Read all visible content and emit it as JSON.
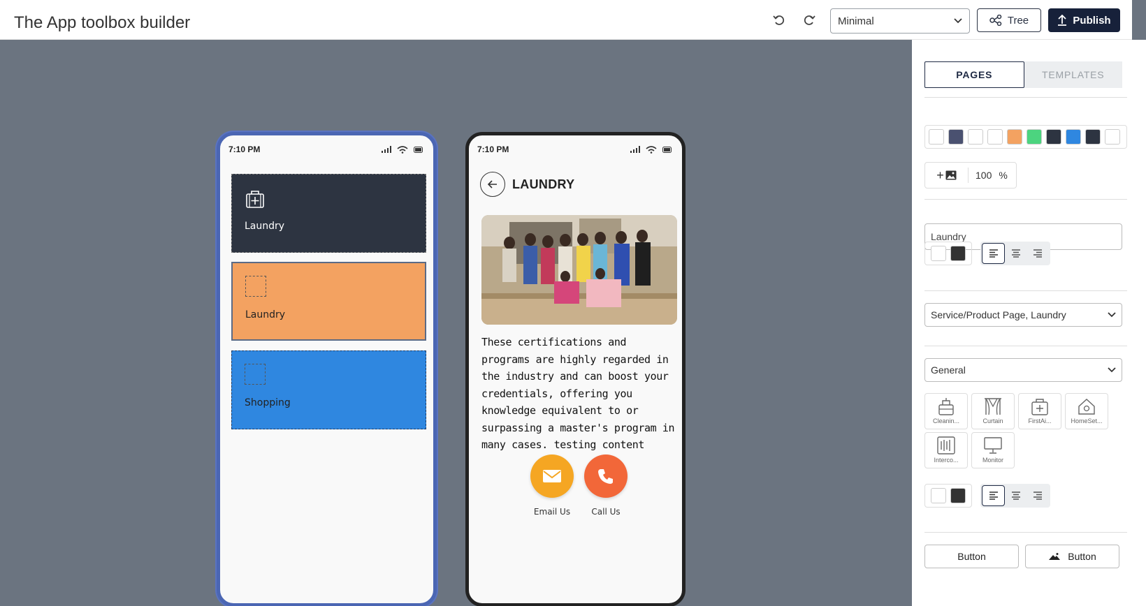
{
  "header": {
    "title": "The App toolbox builder",
    "theme_selected": "Minimal",
    "tree_label": "Tree",
    "publish_label": "Publish"
  },
  "left_phone": {
    "time": "7:10 PM",
    "tiles": [
      {
        "label": "Laundry",
        "color": "#2d3441"
      },
      {
        "label": "Laundry",
        "color": "#f3a261"
      },
      {
        "label": "Shopping",
        "color": "#2f87e0"
      }
    ]
  },
  "right_phone": {
    "time": "7:10 PM",
    "heading": "LAUNDRY",
    "body_text": "These certifications and programs are highly regarded in the industry and can boost your credentials, offering you knowledge equivalent to or surpassing a master's program in many cases. testing content",
    "email_label": "Email Us",
    "call_label": "Call Us"
  },
  "panel": {
    "tabs": [
      "PAGES",
      "TEMPLATES"
    ],
    "active_tab": "PAGES",
    "palette": [
      "#ffffff",
      "#4a5170",
      "#ffffff",
      "#ffffff",
      "#f3a261",
      "#4cd47f",
      "#2d3441",
      "#2f87e0",
      "#2d3441",
      "#ffffff"
    ],
    "image_scale": "100",
    "image_scale_unit": "%",
    "title_value": "Laundry",
    "page_type": "Service/Product Page, Laundry",
    "icon_category": "General",
    "icons": [
      "Cleanin...",
      "Curtain",
      "FirstAi...",
      "HomeSet...",
      "Interco...",
      "Monitor"
    ],
    "button_labels": [
      "Button",
      "Button"
    ]
  }
}
